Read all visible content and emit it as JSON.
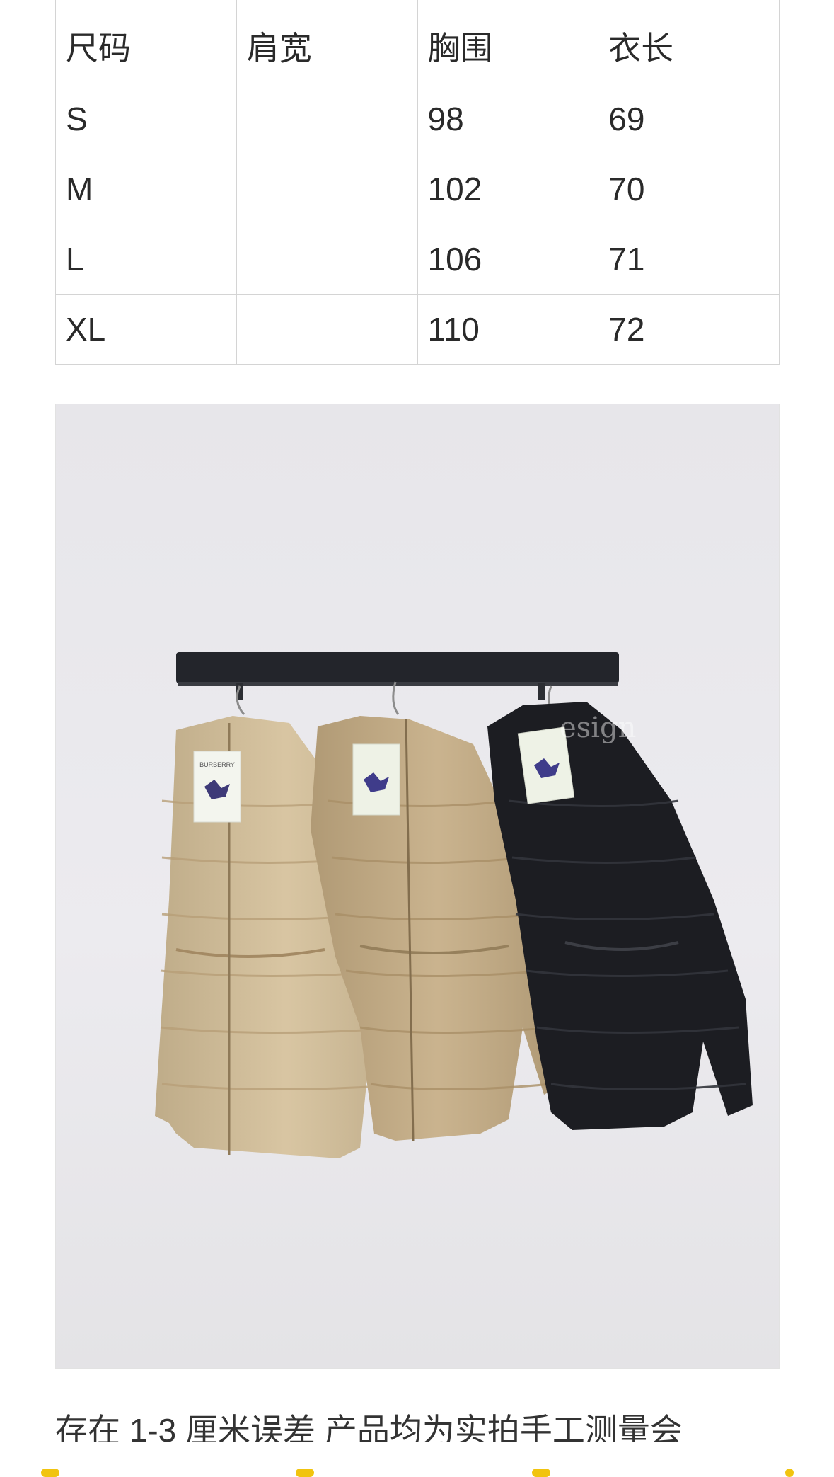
{
  "size_table": {
    "headers": [
      "尺码",
      "肩宽",
      "胸围",
      "衣长"
    ],
    "rows": [
      [
        "S",
        "",
        "98",
        "69"
      ],
      [
        "M",
        "",
        "102",
        "70"
      ],
      [
        "L",
        "",
        "106",
        "71"
      ],
      [
        "XL",
        "",
        "110",
        "72"
      ]
    ]
  },
  "product_photo": {
    "tag_brand": "BURBERRY",
    "watermark": "esign",
    "jacket_colors": [
      "#d4bf98",
      "#c4ab82",
      "#1c1d22"
    ],
    "wall_color": "#ebeaee"
  },
  "note_text": "存在 1-3 厘米误差 产品均为实拍手工测量会",
  "accent_color": "#f1c40f"
}
